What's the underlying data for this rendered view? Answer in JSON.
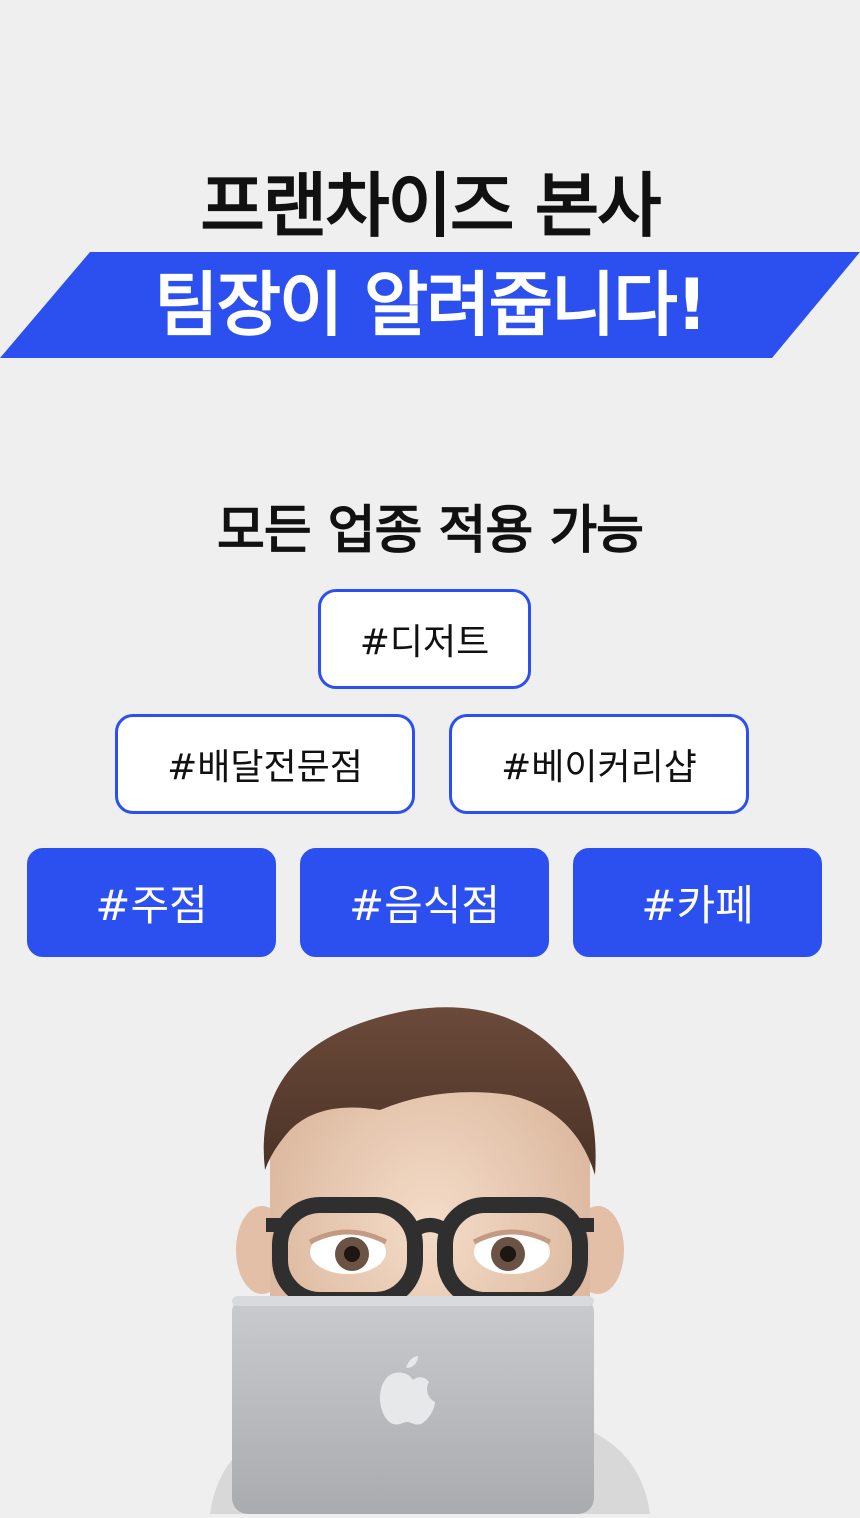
{
  "headline": {
    "line1": "프랜차이즈 본사",
    "line2": "팀장이 알려줍니다!"
  },
  "subtitle": "모든 업종 적용 가능",
  "tags": {
    "row1": [
      "#디저트"
    ],
    "row2": [
      "#배달전문점",
      "#베이커리샵"
    ],
    "row3": [
      "#주점",
      "#음식점",
      "#카페"
    ]
  },
  "colors": {
    "accent": "#2c50f0",
    "background": "#efefef"
  },
  "illustration": {
    "icon": "memoji-with-laptop-icon"
  }
}
